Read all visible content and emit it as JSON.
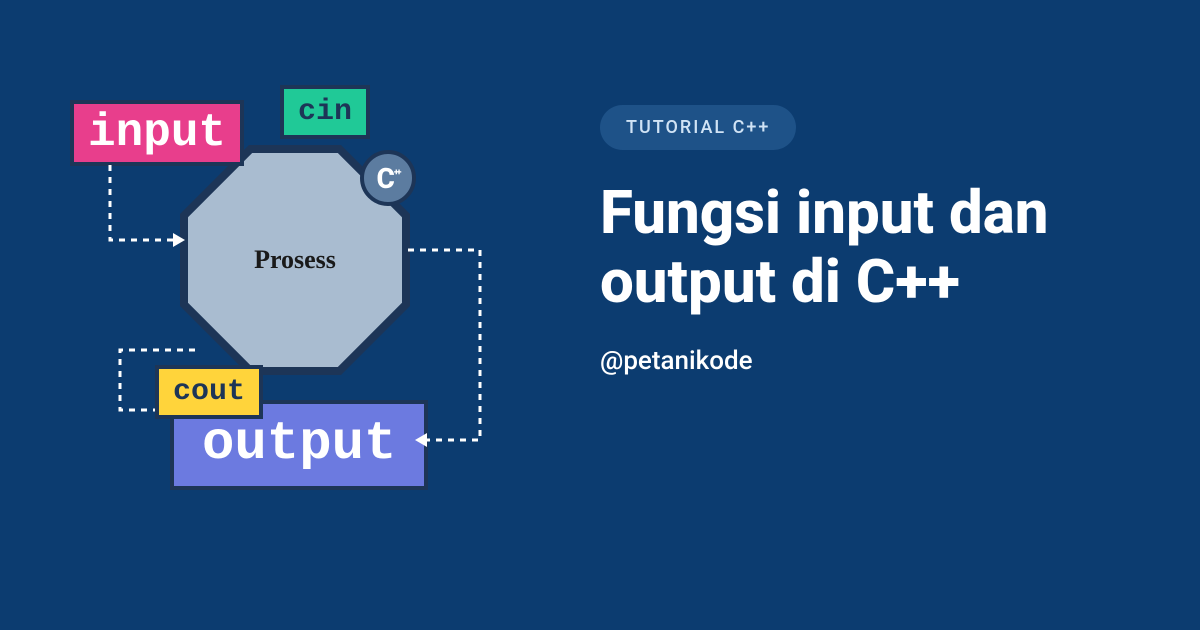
{
  "diagram": {
    "input_label": "input",
    "cin_label": "cin",
    "process_label": "Prosess",
    "cpp_badge": "C",
    "cpp_badge_plus": "++",
    "cout_label": "cout",
    "output_label": "output"
  },
  "content": {
    "category": "TUTORIAL  C++",
    "title": "Fungsi input dan output di C++",
    "handle": "@petanikode"
  },
  "colors": {
    "bg": "#0c3c70",
    "input_box": "#e83e8c",
    "cin_box": "#20c997",
    "cout_box": "#ffd43b",
    "output_box": "#6c7ae0",
    "octagon_fill": "#a9bcd0",
    "dark_border": "#1d3557"
  }
}
